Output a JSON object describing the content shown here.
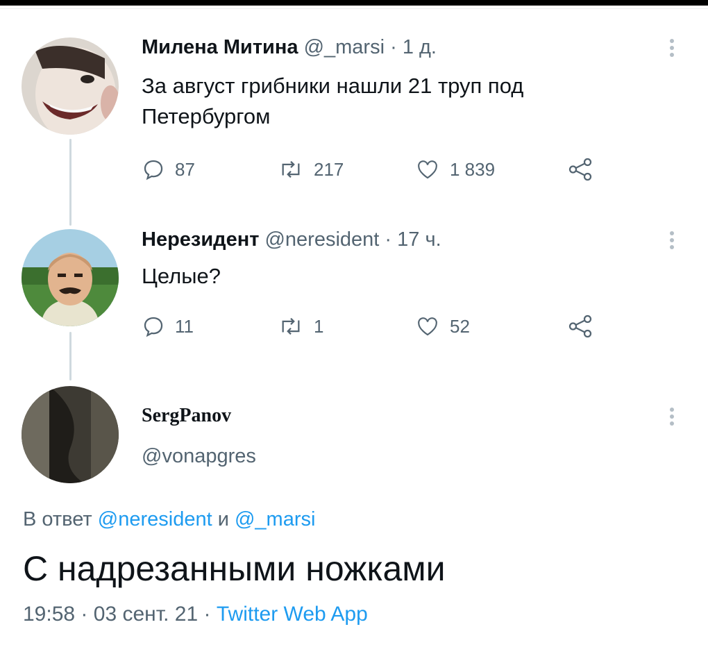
{
  "tweets": [
    {
      "name": "Милена Митина",
      "handle": "@_marsi",
      "sep": "·",
      "time": "1 д.",
      "text_lines": [
        "За август грибники нашли 21 труп под",
        "Петербургом"
      ],
      "replies": "87",
      "retweets": "217",
      "likes": "1 839"
    },
    {
      "name": "Нерезидент",
      "handle": "@neresident",
      "sep": "·",
      "time": "17 ч.",
      "text_lines": [
        "Целые?"
      ],
      "replies": "11",
      "retweets": "1",
      "likes": "52"
    }
  ],
  "main_tweet": {
    "name": "SergPanov",
    "handle": "@vonapgres",
    "reply_prefix": "В ответ",
    "reply_user1": "@neresident",
    "reply_and": "и",
    "reply_user2": "@_marsi",
    "text": "С надрезанными ножками",
    "time": "19:58",
    "sep": "·",
    "date": "03 сент. 21",
    "sep2": "·",
    "source": "Twitter Web App"
  },
  "icons": {
    "reply": "reply-icon",
    "retweet": "retweet-icon",
    "like": "heart-icon",
    "share": "share-icon",
    "more": "more-vertical-icon"
  },
  "colors": {
    "link": "#1d9bf0",
    "muted": "#536471",
    "text": "#0f1419",
    "thread_line": "#cfd9de"
  }
}
